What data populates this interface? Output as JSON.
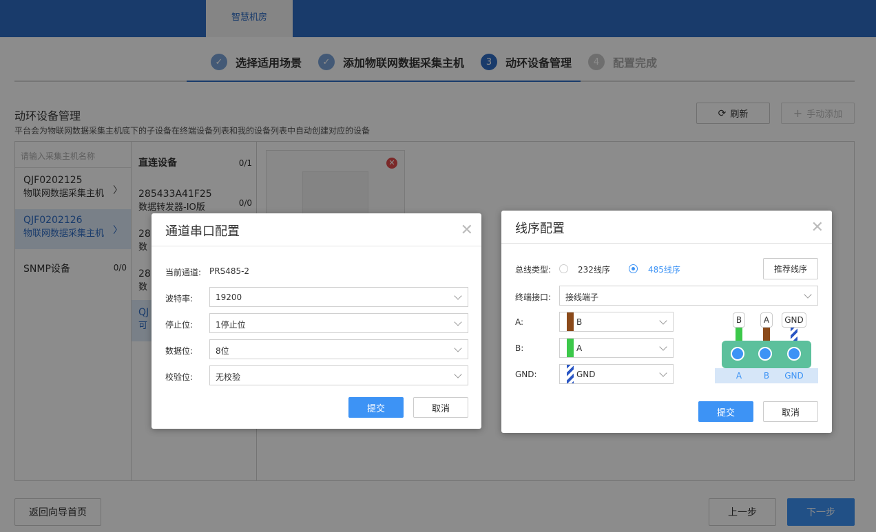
{
  "header": {
    "active_tab": "智慧机房"
  },
  "steps": [
    {
      "num": "✓",
      "label": "选择适用场景",
      "state": "done"
    },
    {
      "num": "✓",
      "label": "添加物联网数据采集主机",
      "state": "done"
    },
    {
      "num": "3",
      "label": "动环设备管理",
      "state": "active"
    },
    {
      "num": "4",
      "label": "配置完成",
      "state": "todo"
    }
  ],
  "section": {
    "title": "动环设备管理",
    "desc": "平台会为物联网数据采集主机底下的子设备在终端设备列表和我的设备列表中自动创建对应的设备",
    "refresh_label": "刷新",
    "add_label": "手动添加"
  },
  "hosts": {
    "search_placeholder": "请输入采集主机名称",
    "items": [
      {
        "name": "QJF0202125",
        "sub": "物联网数据采集主机"
      },
      {
        "name": "QJF0202126",
        "sub": "物联网数据采集主机"
      },
      {
        "name": "SNMP设备",
        "count": "0/0"
      }
    ]
  },
  "devices": {
    "group_label": "直连设备",
    "group_count": "0/1",
    "items": [
      {
        "name": "285433A41F25",
        "sub": "数据转发器-IO版",
        "count": "0/0"
      },
      {
        "name": "28",
        "sub": "数"
      },
      {
        "name": "28",
        "sub": "数"
      },
      {
        "name": "QJ",
        "sub": "可"
      }
    ]
  },
  "footer": {
    "back_home": "返回向导首页",
    "prev": "上一步",
    "next": "下一步"
  },
  "serial_dialog": {
    "title": "通道串口配置",
    "channel_label": "当前通道:",
    "channel_value": "PRS485-2",
    "baud_label": "波特率:",
    "baud_value": "19200",
    "stop_label": "停止位:",
    "stop_value": "1停止位",
    "data_label": "数据位:",
    "data_value": "8位",
    "parity_label": "校验位:",
    "parity_value": "无校验",
    "submit": "提交",
    "cancel": "取消"
  },
  "wire_dialog": {
    "title": "线序配置",
    "bus_label": "总线类型:",
    "opt_232": "232线序",
    "opt_485": "485线序",
    "recommend": "推荐线序",
    "port_label": "终端接口:",
    "port_value": "接线端子",
    "a_label": "A:",
    "a_value": "B",
    "b_label": "B:",
    "b_value": "A",
    "gnd_label": "GND:",
    "gnd_value": "GND",
    "diagram": {
      "tags": [
        "B",
        "A",
        "GND"
      ],
      "pins": [
        "A",
        "B",
        "GND"
      ]
    },
    "submit": "提交",
    "cancel": "取消",
    "colors": {
      "brown": "#8b4a1a",
      "green": "#3cc84a",
      "blue_stripe": "#2a56c4"
    }
  }
}
